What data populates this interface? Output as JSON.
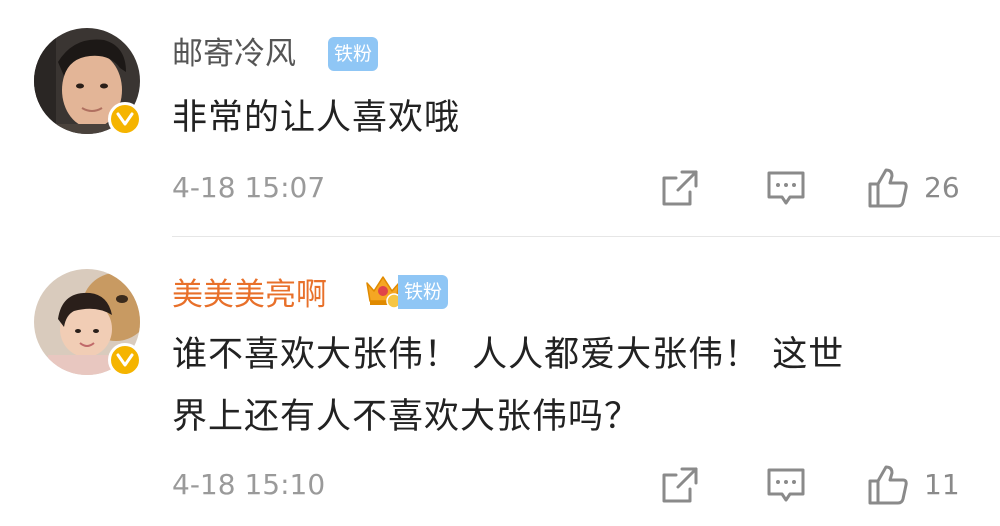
{
  "comments": [
    {
      "username": "邮寄冷风",
      "username_color": "#555555",
      "badge": "铁粉",
      "text_lines": [
        "非常的让人喜欢哦"
      ],
      "time": "4-18 15:07",
      "like_count": "26"
    },
    {
      "username": "美美美亮啊",
      "username_color": "#e8702a",
      "badge": "铁粉",
      "text_lines": [
        "谁不喜欢大张伟！ 人人都爱大张伟！ 这世",
        "界上还有人不喜欢大张伟吗？"
      ],
      "time": "4-18 15:10",
      "like_count": "11"
    }
  ],
  "icons": {
    "verified": "verified-v-icon",
    "share": "share-icon",
    "reply": "comment-icon",
    "like": "thumbs-up-icon",
    "vip": "crown-icon"
  },
  "colors": {
    "badge_bg": "#8fc6f5",
    "verified": "#f5b400",
    "icon_gray": "#8a8a8a"
  }
}
